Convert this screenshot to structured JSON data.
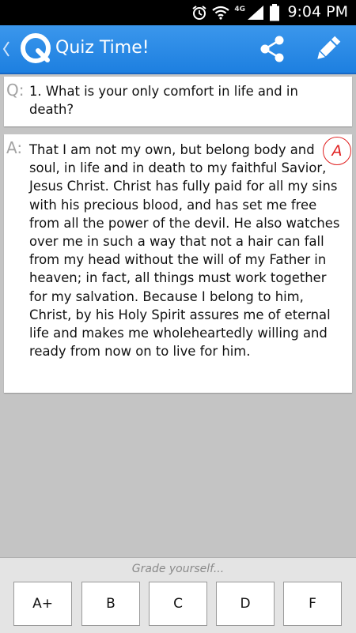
{
  "status_bar": {
    "time": "9:04 PM",
    "network": "4G",
    "icons": [
      "alarm-icon",
      "wifi-icon",
      "signal-icon",
      "battery-icon"
    ]
  },
  "action_bar": {
    "title": "Quiz Time!",
    "icons": [
      "back-chevron-icon",
      "app-logo-icon",
      "share-icon",
      "pencil-icon"
    ],
    "color": "#2a8ae6"
  },
  "question": {
    "marker": "Q:",
    "text": "1. What is your only comfort in life and in death?"
  },
  "answer": {
    "marker": "A:",
    "text": "That I am not my own, but belong body and soul, in life and in death to my faithful Savior, Jesus Christ. Christ has fully paid for all my sins with his precious blood, and has set me free from all the power of the devil. He also watches over me in such a way that not a hair can fall from my head without the will of my Father in heaven; in fact, all things must work together for my salvation. Because I belong to him, Christ, by his Holy Spirit assures me of eternal life and makes me wholeheartedly willing and ready from now on to live for him.",
    "grade_stamp": "A",
    "stamp_color": "#e02020"
  },
  "grading": {
    "prompt": "Grade yourself...",
    "buttons": [
      "A+",
      "B",
      "C",
      "D",
      "F"
    ]
  }
}
